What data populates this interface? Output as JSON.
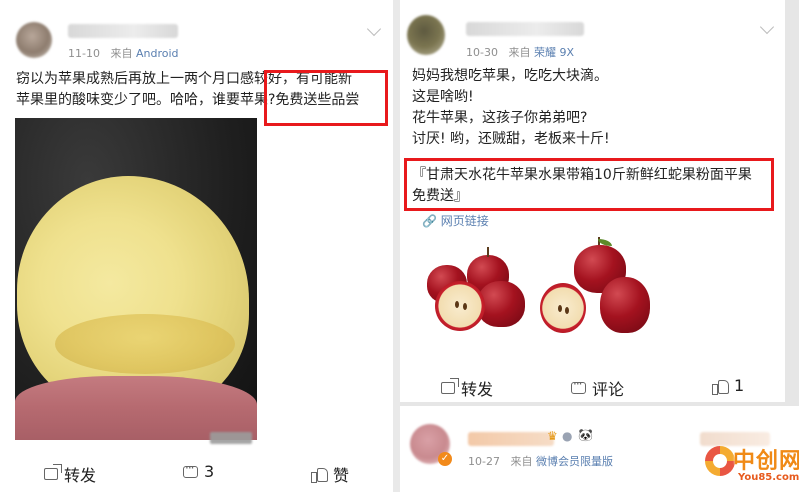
{
  "left_post": {
    "timestamp": "11-10",
    "source_prefix": "来自",
    "source": "Android",
    "text_lines": [
      "窃以为苹果成熟后再放上一两个月口感较好，有可能新",
      "苹果里的酸味变少了吧。哈哈，谁要苹果?免费送些品尝"
    ],
    "highlight": "免费送些品尝",
    "actions": {
      "share_label": "转发",
      "comment_count": "3",
      "like_label": "赞"
    }
  },
  "right_post": {
    "timestamp": "10-30",
    "source_prefix": "来自",
    "source": "荣耀 9X",
    "text_lines": [
      "妈妈我想吃苹果，吃吃大块滴。",
      "这是啥哟!",
      "花牛苹果，这孩子你弟弟吧?",
      "讨厌! 哟，还贼甜，老板来十斤!"
    ],
    "quote_lines": [
      "『甘肃天水花牛苹果水果带箱10斤新鲜红蛇果粉面平果",
      "免费送』"
    ],
    "link_label": "网页链接",
    "actions": {
      "share_label": "转发",
      "comment_label": "评论",
      "like_count": "1"
    }
  },
  "bottom_post": {
    "timestamp": "10-27",
    "source_prefix": "来自",
    "source": "微博会员限量版"
  },
  "watermark": {
    "name": "中创网",
    "site": "You85.com"
  },
  "colors": {
    "highlight_red": "#e8191c",
    "link_blue": "#5a7fb0",
    "meta_gray": "#8f8f8f"
  }
}
